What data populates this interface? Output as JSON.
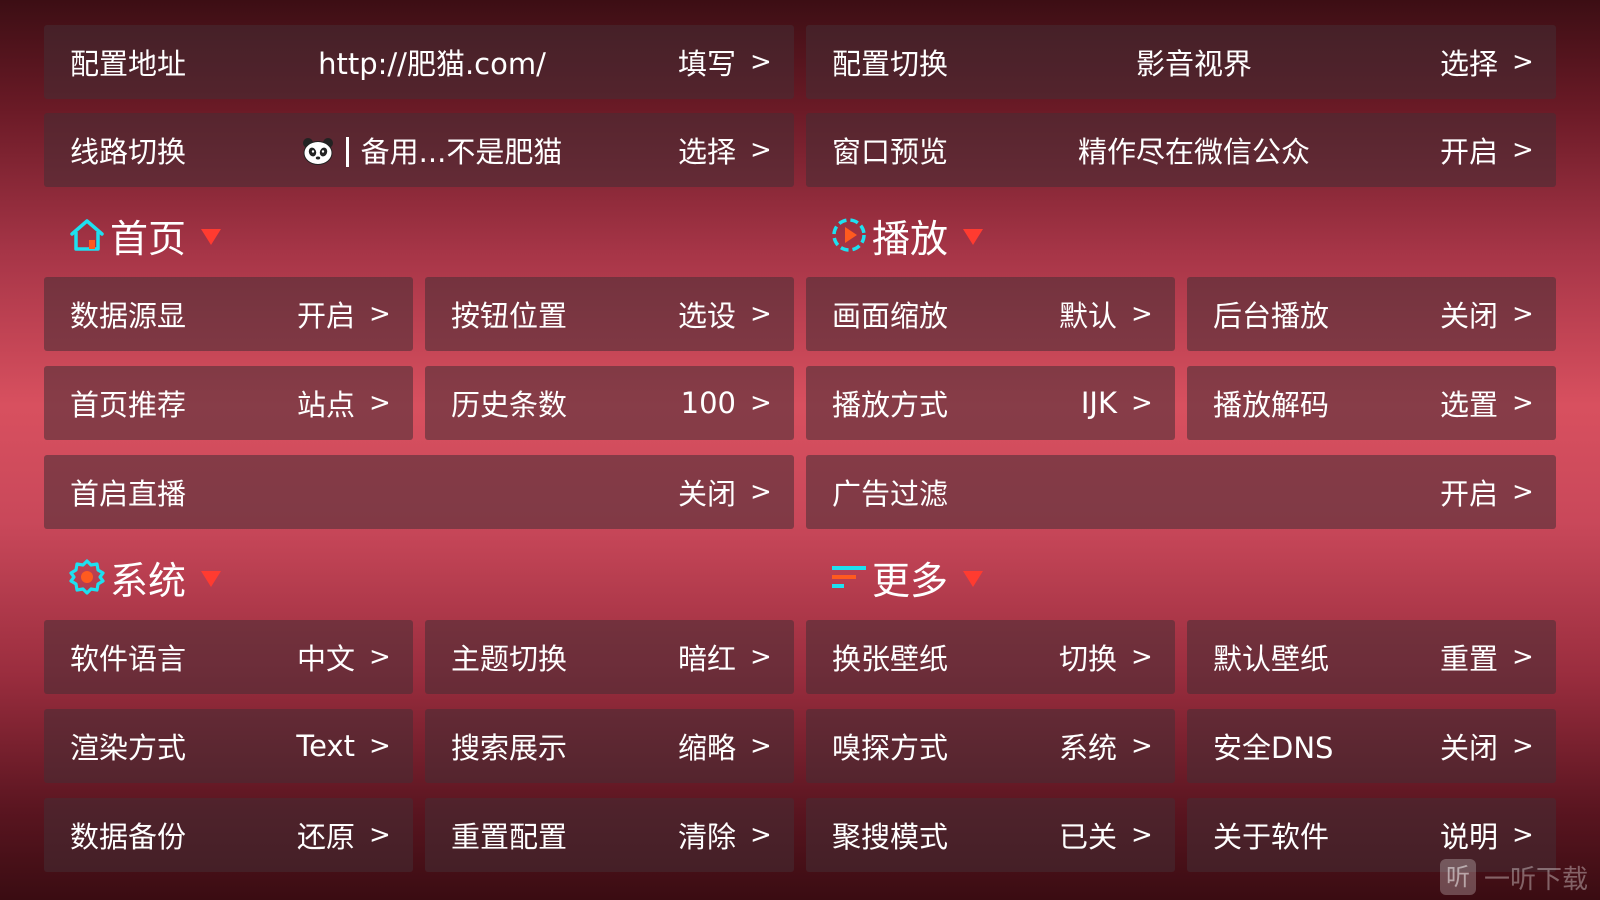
{
  "top": {
    "config_address": {
      "label": "配置地址",
      "value": "http://肥猫.com/",
      "action": "填写",
      "arrow": ">"
    },
    "config_switch": {
      "label": "配置切换",
      "value": "影音视界",
      "action": "选择",
      "arrow": ">"
    },
    "line_switch": {
      "label": "线路切换",
      "value": "备用...不是肥猫",
      "action": "选择",
      "arrow": ">"
    },
    "window_preview": {
      "label": "窗口预览",
      "value": "精作尽在微信公众",
      "action": "开启",
      "arrow": ">"
    }
  },
  "sections": {
    "home": {
      "title": "首页"
    },
    "playback": {
      "title": "播放"
    },
    "system": {
      "title": "系统"
    },
    "more": {
      "title": "更多"
    }
  },
  "home": {
    "items": [
      {
        "label": "数据源显",
        "value": "开启",
        "arrow": ">"
      },
      {
        "label": "按钮位置",
        "value": "选设",
        "arrow": ">"
      },
      {
        "label": "首页推荐",
        "value": "站点",
        "arrow": ">"
      },
      {
        "label": "历史条数",
        "value": "100",
        "arrow": ">"
      },
      {
        "label": "首启直播",
        "value": "关闭",
        "arrow": ">"
      }
    ]
  },
  "playback": {
    "items": [
      {
        "label": "画面缩放",
        "value": "默认",
        "arrow": ">"
      },
      {
        "label": "后台播放",
        "value": "关闭",
        "arrow": ">"
      },
      {
        "label": "播放方式",
        "value": "IJK",
        "arrow": ">"
      },
      {
        "label": "播放解码",
        "value": "选置",
        "arrow": ">"
      },
      {
        "label": "广告过滤",
        "value": "开启",
        "arrow": ">"
      }
    ]
  },
  "system": {
    "items": [
      {
        "label": "软件语言",
        "value": "中文",
        "arrow": ">"
      },
      {
        "label": "主题切换",
        "value": "暗红",
        "arrow": ">"
      },
      {
        "label": "渲染方式",
        "value": "Text",
        "arrow": ">"
      },
      {
        "label": "搜索展示",
        "value": "缩略",
        "arrow": ">"
      },
      {
        "label": "数据备份",
        "value": "还原",
        "arrow": ">"
      },
      {
        "label": "重置配置",
        "value": "清除",
        "arrow": ">"
      }
    ]
  },
  "more": {
    "items": [
      {
        "label": "换张壁纸",
        "value": "切换",
        "arrow": ">"
      },
      {
        "label": "默认壁纸",
        "value": "重置",
        "arrow": ">"
      },
      {
        "label": "嗅探方式",
        "value": "系统",
        "arrow": ">"
      },
      {
        "label": "安全DNS",
        "value": "关闭",
        "arrow": ">"
      },
      {
        "label": "聚搜模式",
        "value": "已关",
        "arrow": ">"
      },
      {
        "label": "关于软件",
        "value": "说明",
        "arrow": ">"
      }
    ]
  },
  "watermark": {
    "logo": "听",
    "text": "一听下载"
  },
  "colors": {
    "icon_cyan": "#1ee0f0",
    "icon_orange": "#ff5a1f",
    "triangle_red": "#ff3b30"
  }
}
